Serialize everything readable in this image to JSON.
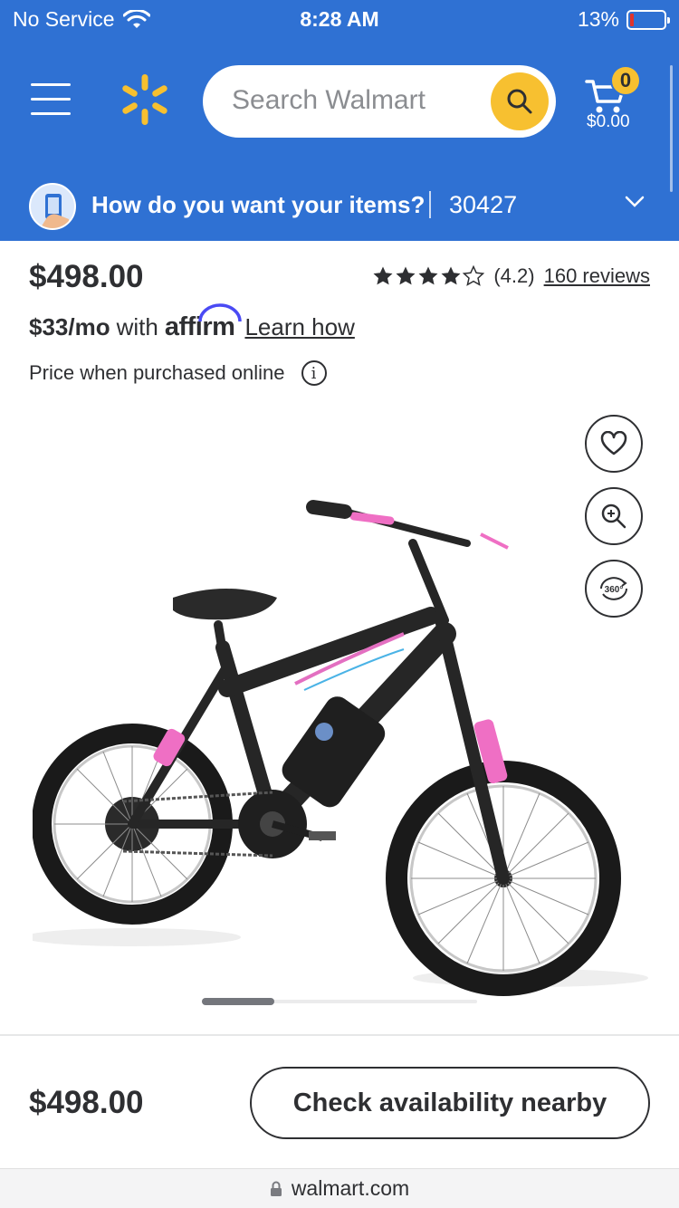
{
  "status_bar": {
    "carrier": "No Service",
    "time": "8:28 AM",
    "battery": "13%"
  },
  "header": {
    "search_placeholder": "Search Walmart",
    "cart_count": "0",
    "cart_total": "$0.00"
  },
  "delivery": {
    "question": "How do you want your items?",
    "zip": "30427"
  },
  "product": {
    "price": "$498.00",
    "rating_value": 4.2,
    "rating_text": "(4.2)",
    "reviews": "160 reviews",
    "monthly": "$33/mo",
    "with": "with",
    "affirm_logo": "affirm",
    "learn_how": "Learn how",
    "price_note": "Price when purchased online",
    "image_count_position": "1 of 4"
  },
  "footer": {
    "price": "$498.00",
    "availability_button": "Check availability nearby"
  },
  "url_bar": {
    "domain": "walmart.com"
  },
  "colors": {
    "brand_blue": "#2f71d3",
    "spark_yellow": "#f7c030",
    "text_dark": "#2e2f32",
    "affirm_purple": "#4a4af4"
  }
}
